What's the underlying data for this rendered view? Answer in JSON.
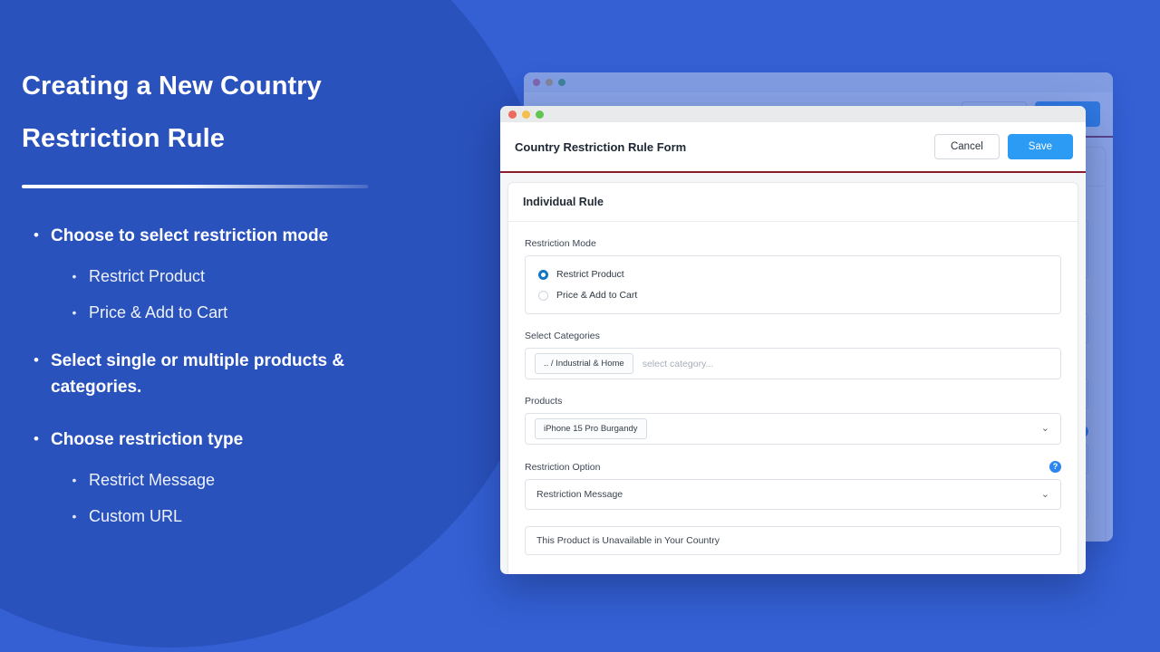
{
  "theme": {
    "bg_blue": "#3460d4",
    "circle_blue": "#2a52bd",
    "accent_blue": "#2b9bf4",
    "divider_red": "#8c1c2a"
  },
  "slide": {
    "title": "Creating a New Country Restriction Rule",
    "bullets": [
      {
        "level": 1,
        "text": "Choose to select restriction mode",
        "children": [
          {
            "level": 2,
            "text": "Restrict Product"
          },
          {
            "level": 2,
            "text": "Price & Add to Cart"
          }
        ]
      },
      {
        "level": 1,
        "text": "Select single or multiple products & categories.",
        "children": []
      },
      {
        "level": 1,
        "text": "Choose restriction type",
        "children": [
          {
            "level": 2,
            "text": "Restrict Message"
          },
          {
            "level": 2,
            "text": "Custom URL"
          }
        ]
      }
    ],
    "bullet_marker": "•"
  },
  "window": {
    "traffic_lights": [
      "close-red",
      "minimize-yellow",
      "zoom-green"
    ],
    "header": {
      "title": "Country Restriction Rule Form",
      "cancel_label": "Cancel",
      "save_label": "Save"
    },
    "card": {
      "heading": "Individual Rule",
      "fields": {
        "restriction_mode": {
          "label": "Restriction Mode",
          "options": [
            {
              "label": "Restrict Product",
              "selected": true
            },
            {
              "label": "Price & Add to Cart",
              "selected": false
            }
          ]
        },
        "select_categories": {
          "label": "Select Categories",
          "tag": ".. / Industrial & Home",
          "placeholder": "select category..."
        },
        "products": {
          "label": "Products",
          "tag": "iPhone 15 Pro Burgandy",
          "chevron": "⌄"
        },
        "restriction_option": {
          "label": "Restriction Option",
          "help_icon": "?",
          "value": "Restriction Message",
          "chevron": "⌄"
        },
        "restriction_message": {
          "value": "This Product is Unavailable in Your Country"
        }
      }
    }
  }
}
